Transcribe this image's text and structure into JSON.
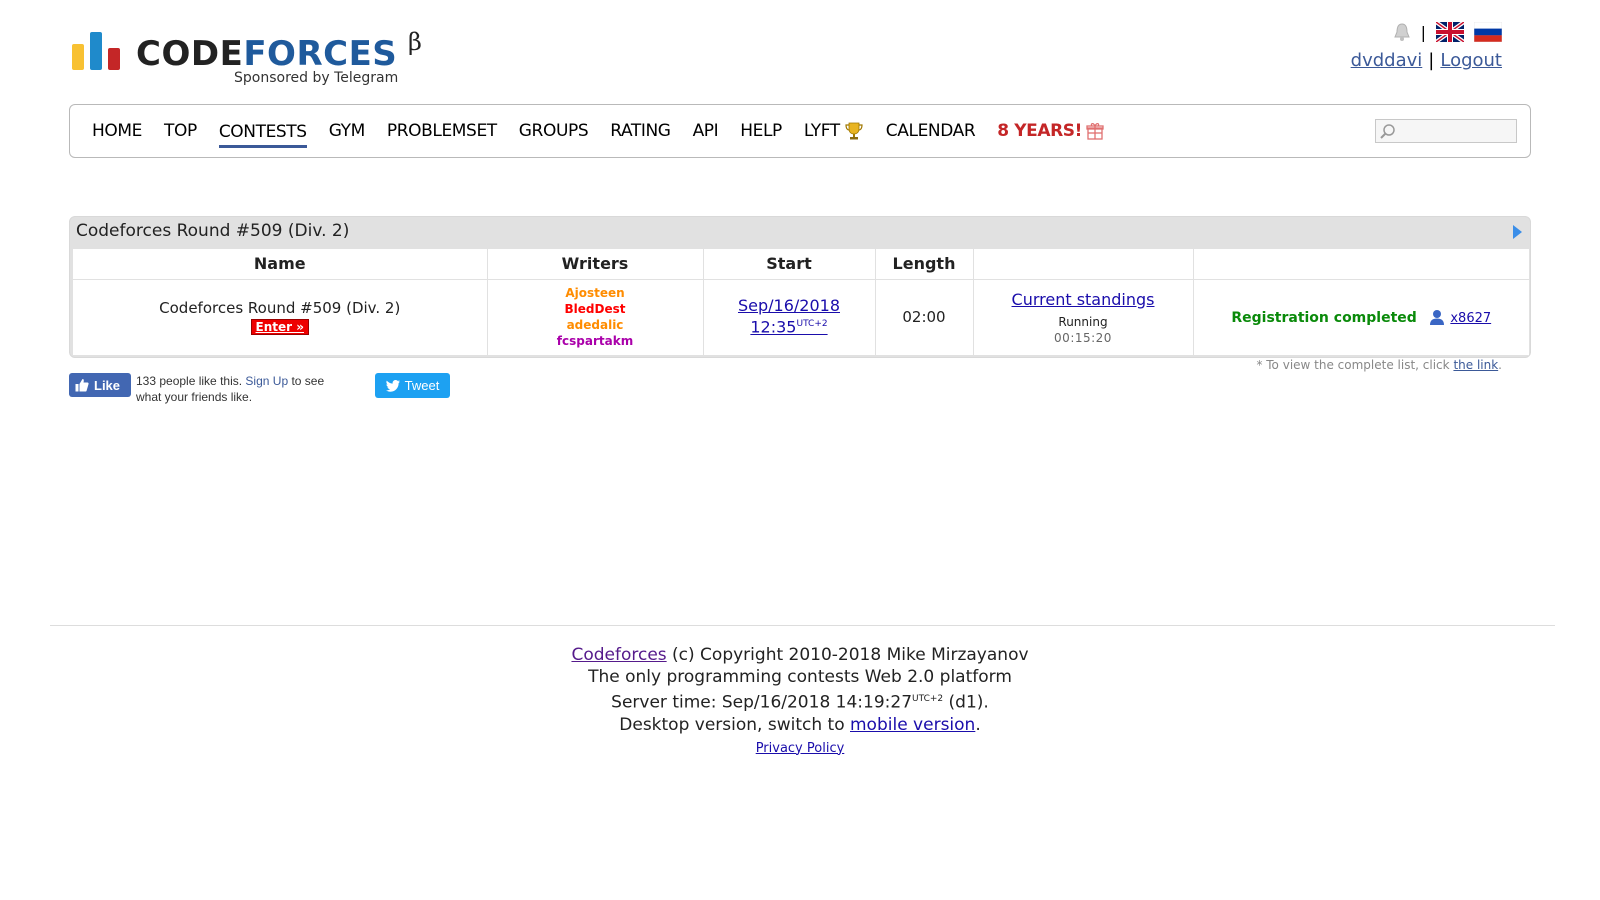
{
  "header": {
    "logo_word_part1": "CODE",
    "logo_word_part2": "FORCES",
    "logo_beta": "β",
    "logo_sponsor": "Sponsored by Telegram",
    "separator": "|",
    "username": "dvddavi",
    "logout_label": "Logout",
    "user_separator": "|"
  },
  "menu": {
    "items": [
      "HOME",
      "TOP",
      "CONTESTS",
      "GYM",
      "PROBLEMSET",
      "GROUPS",
      "RATING",
      "API",
      "HELP",
      "LYFT",
      "CALENDAR"
    ],
    "special_label": "8 YEARS!",
    "active_item": "CONTESTS",
    "search_placeholder": ""
  },
  "contest": {
    "title": "Codeforces Round #509 (Div. 2)",
    "columns": [
      "Name",
      "Writers",
      "Start",
      "Length",
      "",
      ""
    ],
    "row": {
      "name": "Codeforces Round #509 (Div. 2)",
      "enter_label": "Enter »",
      "writers": [
        {
          "name": "Ajosteen",
          "color": "#ff8c00"
        },
        {
          "name": "BledDest",
          "color": "#ff0000"
        },
        {
          "name": "adedalic",
          "color": "#ff8c00"
        },
        {
          "name": "fcspartakm",
          "color": "#aa00aa"
        }
      ],
      "start_date": "Sep/16/2018",
      "start_time": "12:35",
      "start_tz": "UTC+2",
      "length": "02:00",
      "standings_label": "Current standings",
      "status": "Running",
      "timer": "00:15:20",
      "registration_label": "Registration completed",
      "registrants": "x8627"
    },
    "hint_prefix": "* To view the complete list, click",
    "hint_link": "the link",
    "hint_suffix": "."
  },
  "social": {
    "like_label": "Like",
    "like_text_prefix": "133 people like this.",
    "signup_label": "Sign Up",
    "like_text_suffix": "to see what your friends like.",
    "tweet_label": "Tweet"
  },
  "footer": {
    "site_link": "Codeforces",
    "copyright": "(c) Copyright 2010-2018 Mike Mirzayanov",
    "tagline": "The only programming contests Web 2.0 platform",
    "server_time_prefix": "Server time: Sep/16/2018 14:19:27",
    "server_tz": "UTC+2",
    "server_time_suffix": "(d1).",
    "desktop_prefix": "Desktop version, switch to",
    "mobile_link": "mobile version",
    "desktop_suffix": ".",
    "privacy_link": "Privacy Policy"
  },
  "colors": {
    "brand_blue": "#3b5998",
    "logo_yellow": "#f8c132",
    "logo_blue": "#1f8acb",
    "logo_red": "#c42627",
    "registration_green": "#0a8a0a",
    "enter_red": "#e00000"
  },
  "icons": [
    "bell-icon",
    "uk-flag-icon",
    "russia-flag-icon",
    "trophy-icon",
    "gift-icon",
    "search-icon",
    "arrow-right-icon",
    "user-icon",
    "thumbs-up-icon",
    "twitter-bird-icon"
  ]
}
